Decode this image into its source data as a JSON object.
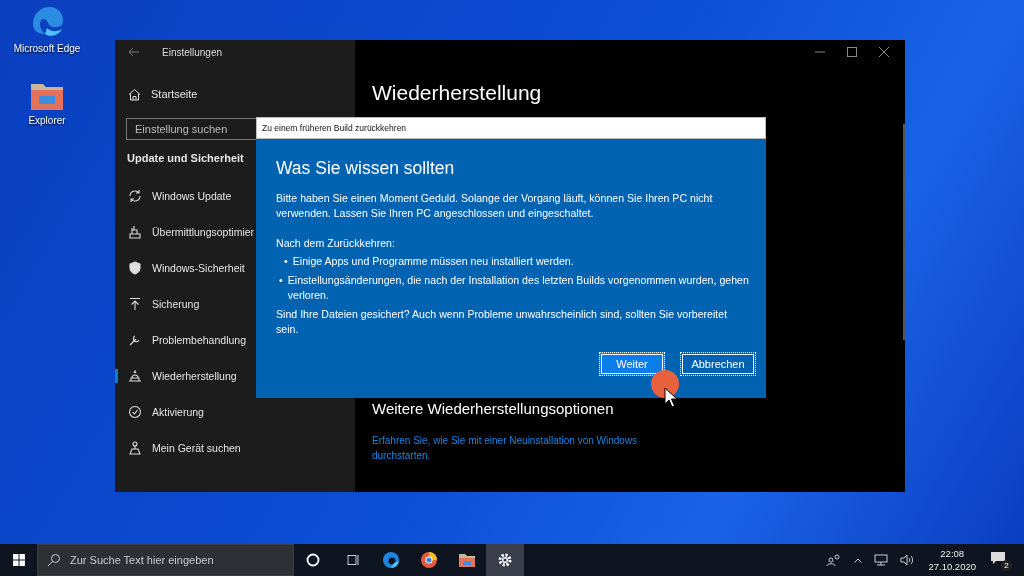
{
  "desktop_icons": [
    {
      "label": "Microsoft Edge"
    },
    {
      "label": "Explorer"
    }
  ],
  "settings_window": {
    "title": "Einstellungen",
    "home": "Startseite",
    "search": {
      "placeholder": "Einstellung suchen"
    },
    "section": "Update und Sicherheit",
    "nav_items": [
      {
        "label": "Windows Update",
        "selected": false
      },
      {
        "label": "Übermittlungsoptimier",
        "selected": false
      },
      {
        "label": "Windows-Sicherheit",
        "selected": false
      },
      {
        "label": "Sicherung",
        "selected": false
      },
      {
        "label": "Problembehandlung",
        "selected": false
      },
      {
        "label": "Wiederherstellung",
        "selected": true
      },
      {
        "label": "Aktivierung",
        "selected": false
      },
      {
        "label": "Mein Gerät suchen",
        "selected": false
      }
    ],
    "page_title": "Wiederherstellung",
    "subheading": "Weitere Wiederherstellungsoptionen",
    "link": "Erfahren Sie, wie Sie mit einer Neuinstallation von Windows durchstarten."
  },
  "dialog": {
    "title": "Zu einem früheren Build zurückkehren",
    "heading": "Was Sie wissen sollten",
    "intro": "Bitte haben Sie einen Moment Geduld. Solange der Vorgang läuft, können Sie Ihren PC nicht verwenden. Lassen Sie Ihren PC angeschlossen und eingeschaltet.",
    "list_intro": "Nach dem Zurückkehren:",
    "bullets": [
      {
        "marker": "•",
        "text": "Einige Apps und Programme müssen neu installiert werden."
      },
      {
        "marker": "•",
        "text": "Einstellungsänderungen, die nach der Installation des letzten Builds vorgenommen wurden, gehen verloren."
      }
    ],
    "closing": "Sind Ihre Dateien gesichert? Auch wenn Probleme unwahrscheinlich sind, sollten Sie vorbereitet sein.",
    "buttons": [
      {
        "label": "Weiter",
        "default": true
      },
      {
        "label": "Abbrechen",
        "default": false
      }
    ]
  },
  "taskbar": {
    "search": {
      "placeholder": "Zur Suche Text hier eingeben"
    },
    "apps": [
      {
        "selected": false
      },
      {
        "selected": false
      },
      {
        "selected": false
      },
      {
        "selected": true
      }
    ],
    "time": "22:08",
    "date": "27.10.2020",
    "notification_count": "2"
  }
}
